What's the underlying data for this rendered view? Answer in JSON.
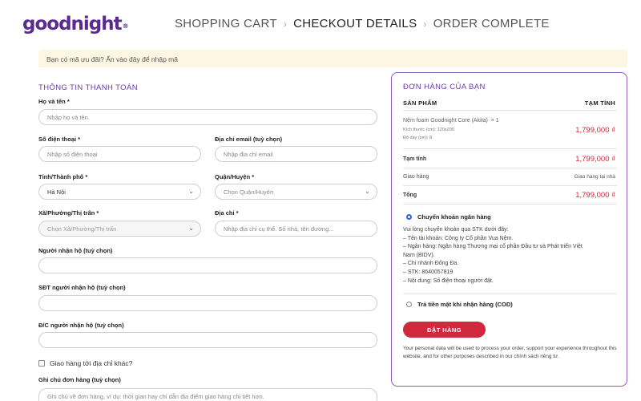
{
  "header": {
    "logo": "goodnight",
    "logo_mark": "®",
    "steps": [
      {
        "label": "SHOPPING CART"
      },
      {
        "label": "CHECKOUT DETAILS"
      },
      {
        "label": "ORDER COMPLETE"
      }
    ],
    "separator": "›"
  },
  "coupon": {
    "text": "Bạn có mã ưu đãi? Ấn vào đây để nhập mã"
  },
  "billing": {
    "title": "THÔNG TIN THANH TOÁN",
    "full_name": {
      "label": "Họ và tên *",
      "placeholder": "Nhập họ và tên"
    },
    "phone": {
      "label": "Số điện thoại *",
      "placeholder": "Nhập số điện thoại"
    },
    "email": {
      "label": "Địa chỉ email (tuỳ chọn)",
      "placeholder": "Nhập địa chỉ email"
    },
    "province": {
      "label": "Tỉnh/Thành phố *",
      "value": "Hà Nội"
    },
    "district": {
      "label": "Quận/Huyện *",
      "value": "Chọn Quận/Huyện"
    },
    "ward": {
      "label": "Xã/Phường/Thị trấn *",
      "value": "Chọn Xã/Phường/Thị trấn"
    },
    "address": {
      "label": "Địa chỉ *",
      "placeholder": "Nhập địa chỉ cụ thể. Số nhà, tên đường..."
    },
    "receiver_name": {
      "label": "Người nhận hộ (tuỳ chọn)",
      "value": ""
    },
    "receiver_phone": {
      "label": "SĐT người nhận hộ (tuỳ chọn)",
      "value": ""
    },
    "receiver_address": {
      "label": "Đ/C người nhận hộ (tuỳ chọn)",
      "value": ""
    },
    "ship_different": {
      "label": "Giao hàng tới địa chỉ khác?"
    },
    "order_notes": {
      "label": "Ghi chú đơn hàng (tuỳ chọn)",
      "placeholder": "Ghi chú về đơn hàng, ví dụ: thời gian hay chỉ dẫn địa điểm giao hàng chi tiết hơn."
    }
  },
  "order": {
    "title": "ĐƠN HÀNG CỦA BẠN",
    "col_product": "SẢN PHẨM",
    "col_subtotal": "TẠM TÍNH",
    "product": {
      "name": "Nệm foam Goodnight Core (Akita)",
      "qty": "× 1",
      "size": "Kích thước (cm): 120x200",
      "thickness": "Độ dày (cm): 8",
      "price": "1,799,000 ₫"
    },
    "subtotal": {
      "label": "Tạm tính",
      "value": "1,799,000 ₫"
    },
    "shipping": {
      "label": "Giao hàng",
      "value": "Giao hàng tại nhà"
    },
    "total": {
      "label": "Tổng",
      "value": "1,799,000 ₫"
    },
    "payment_bank": {
      "label": "Chuyển khoản ngân hàng",
      "lines": [
        "Vui lòng chuyển khoản qua STK dưới đây:",
        "– Tên tài khoản: Công ty Cổ phần Vua Nệm.",
        "– Ngân hàng: Ngân hàng Thương mại cổ phần Đầu tư và Phát triển Việt",
        "Nam (BIDV).",
        "– Chi nhánh Đống Đa.",
        "– STK: 8640057819",
        "– Nội dung: Số điện thoại người đặt."
      ]
    },
    "payment_cod": {
      "label": "Trả tiền mặt khi nhận hàng (COD)"
    },
    "place_order": "ĐẶT HÀNG",
    "privacy": "Your personal data will be used to process your order, support your experience throughout this website, and for other purposes described in our chính sách riêng tư."
  },
  "colors": {
    "brand_purple": "#5a2a91",
    "accent_red": "#d0283c",
    "coupon_bg": "#fdf6e3"
  }
}
